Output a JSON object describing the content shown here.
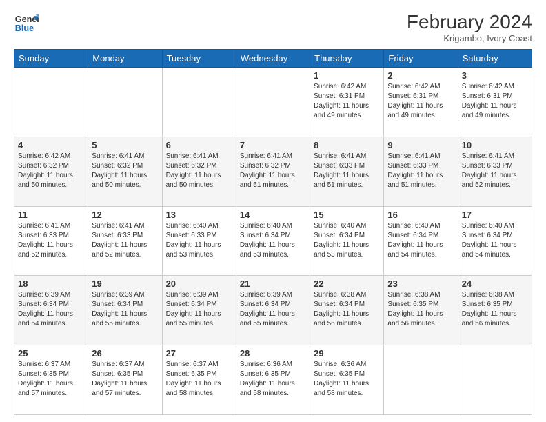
{
  "header": {
    "logo_line1": "General",
    "logo_line2": "Blue",
    "month_year": "February 2024",
    "location": "Krigambo, Ivory Coast"
  },
  "days_of_week": [
    "Sunday",
    "Monday",
    "Tuesday",
    "Wednesday",
    "Thursday",
    "Friday",
    "Saturday"
  ],
  "weeks": [
    [
      {
        "day": "",
        "info": ""
      },
      {
        "day": "",
        "info": ""
      },
      {
        "day": "",
        "info": ""
      },
      {
        "day": "",
        "info": ""
      },
      {
        "day": "1",
        "info": "Sunrise: 6:42 AM\nSunset: 6:31 PM\nDaylight: 11 hours and 49 minutes."
      },
      {
        "day": "2",
        "info": "Sunrise: 6:42 AM\nSunset: 6:31 PM\nDaylight: 11 hours and 49 minutes."
      },
      {
        "day": "3",
        "info": "Sunrise: 6:42 AM\nSunset: 6:31 PM\nDaylight: 11 hours and 49 minutes."
      }
    ],
    [
      {
        "day": "4",
        "info": "Sunrise: 6:42 AM\nSunset: 6:32 PM\nDaylight: 11 hours and 50 minutes."
      },
      {
        "day": "5",
        "info": "Sunrise: 6:41 AM\nSunset: 6:32 PM\nDaylight: 11 hours and 50 minutes."
      },
      {
        "day": "6",
        "info": "Sunrise: 6:41 AM\nSunset: 6:32 PM\nDaylight: 11 hours and 50 minutes."
      },
      {
        "day": "7",
        "info": "Sunrise: 6:41 AM\nSunset: 6:32 PM\nDaylight: 11 hours and 51 minutes."
      },
      {
        "day": "8",
        "info": "Sunrise: 6:41 AM\nSunset: 6:33 PM\nDaylight: 11 hours and 51 minutes."
      },
      {
        "day": "9",
        "info": "Sunrise: 6:41 AM\nSunset: 6:33 PM\nDaylight: 11 hours and 51 minutes."
      },
      {
        "day": "10",
        "info": "Sunrise: 6:41 AM\nSunset: 6:33 PM\nDaylight: 11 hours and 52 minutes."
      }
    ],
    [
      {
        "day": "11",
        "info": "Sunrise: 6:41 AM\nSunset: 6:33 PM\nDaylight: 11 hours and 52 minutes."
      },
      {
        "day": "12",
        "info": "Sunrise: 6:41 AM\nSunset: 6:33 PM\nDaylight: 11 hours and 52 minutes."
      },
      {
        "day": "13",
        "info": "Sunrise: 6:40 AM\nSunset: 6:33 PM\nDaylight: 11 hours and 53 minutes."
      },
      {
        "day": "14",
        "info": "Sunrise: 6:40 AM\nSunset: 6:34 PM\nDaylight: 11 hours and 53 minutes."
      },
      {
        "day": "15",
        "info": "Sunrise: 6:40 AM\nSunset: 6:34 PM\nDaylight: 11 hours and 53 minutes."
      },
      {
        "day": "16",
        "info": "Sunrise: 6:40 AM\nSunset: 6:34 PM\nDaylight: 11 hours and 54 minutes."
      },
      {
        "day": "17",
        "info": "Sunrise: 6:40 AM\nSunset: 6:34 PM\nDaylight: 11 hours and 54 minutes."
      }
    ],
    [
      {
        "day": "18",
        "info": "Sunrise: 6:39 AM\nSunset: 6:34 PM\nDaylight: 11 hours and 54 minutes."
      },
      {
        "day": "19",
        "info": "Sunrise: 6:39 AM\nSunset: 6:34 PM\nDaylight: 11 hours and 55 minutes."
      },
      {
        "day": "20",
        "info": "Sunrise: 6:39 AM\nSunset: 6:34 PM\nDaylight: 11 hours and 55 minutes."
      },
      {
        "day": "21",
        "info": "Sunrise: 6:39 AM\nSunset: 6:34 PM\nDaylight: 11 hours and 55 minutes."
      },
      {
        "day": "22",
        "info": "Sunrise: 6:38 AM\nSunset: 6:34 PM\nDaylight: 11 hours and 56 minutes."
      },
      {
        "day": "23",
        "info": "Sunrise: 6:38 AM\nSunset: 6:35 PM\nDaylight: 11 hours and 56 minutes."
      },
      {
        "day": "24",
        "info": "Sunrise: 6:38 AM\nSunset: 6:35 PM\nDaylight: 11 hours and 56 minutes."
      }
    ],
    [
      {
        "day": "25",
        "info": "Sunrise: 6:37 AM\nSunset: 6:35 PM\nDaylight: 11 hours and 57 minutes."
      },
      {
        "day": "26",
        "info": "Sunrise: 6:37 AM\nSunset: 6:35 PM\nDaylight: 11 hours and 57 minutes."
      },
      {
        "day": "27",
        "info": "Sunrise: 6:37 AM\nSunset: 6:35 PM\nDaylight: 11 hours and 58 minutes."
      },
      {
        "day": "28",
        "info": "Sunrise: 6:36 AM\nSunset: 6:35 PM\nDaylight: 11 hours and 58 minutes."
      },
      {
        "day": "29",
        "info": "Sunrise: 6:36 AM\nSunset: 6:35 PM\nDaylight: 11 hours and 58 minutes."
      },
      {
        "day": "",
        "info": ""
      },
      {
        "day": "",
        "info": ""
      }
    ]
  ]
}
